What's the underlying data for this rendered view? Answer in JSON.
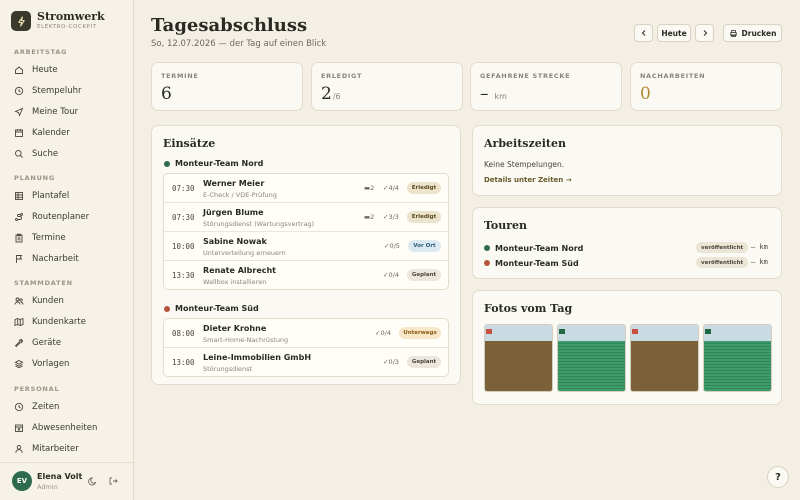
{
  "brand": {
    "name": "Stromwerk",
    "sub": "ELEKTRO-COCKPIT"
  },
  "sidebar": {
    "sections": [
      {
        "label": "ARBEITSTAG",
        "items": [
          {
            "label": "Heute",
            "icon": "home-icon"
          },
          {
            "label": "Stempeluhr",
            "icon": "clock-icon"
          },
          {
            "label": "Meine Tour",
            "icon": "send-icon"
          },
          {
            "label": "Kalender",
            "icon": "calendar-icon"
          },
          {
            "label": "Suche",
            "icon": "search-icon"
          }
        ]
      },
      {
        "label": "PLANUNG",
        "items": [
          {
            "label": "Plantafel",
            "icon": "grid-icon"
          },
          {
            "label": "Routenplaner",
            "icon": "route-icon"
          },
          {
            "label": "Termine",
            "icon": "clipboard-icon"
          },
          {
            "label": "Nacharbeit",
            "icon": "flag-icon"
          }
        ]
      },
      {
        "label": "STAMMDATEN",
        "items": [
          {
            "label": "Kunden",
            "icon": "users-icon"
          },
          {
            "label": "Kundenkarte",
            "icon": "map-icon"
          },
          {
            "label": "Geräte",
            "icon": "wrench-icon"
          },
          {
            "label": "Vorlagen",
            "icon": "layers-icon"
          }
        ]
      },
      {
        "label": "PERSONAL",
        "items": [
          {
            "label": "Zeiten",
            "icon": "clock-icon"
          },
          {
            "label": "Abwesenheiten",
            "icon": "calendar-x-icon"
          },
          {
            "label": "Mitarbeiter",
            "icon": "user-icon"
          }
        ]
      }
    ]
  },
  "user": {
    "initials": "EV",
    "name": "Elena Volt",
    "role": "Admin"
  },
  "header": {
    "title": "Tagesabschluss",
    "subtitle": "So, 12.07.2026 — der Tag auf einen Blick",
    "today_label": "Heute",
    "print_label": "Drucken"
  },
  "stats": [
    {
      "label": "TERMINE",
      "value": "6",
      "unit": ""
    },
    {
      "label": "ERLEDIGT",
      "value": "2",
      "unit": "/6"
    },
    {
      "label": "GEFAHRENE STRECKE",
      "value": "–",
      "unit": "km"
    },
    {
      "label": "NACHARBEITEN",
      "value": "0",
      "unit": ""
    }
  ],
  "einsaetze": {
    "title": "Einsätze",
    "teams": [
      {
        "name": "Monteur-Team Nord",
        "color": "#2e6b4e",
        "rows": [
          {
            "time": "07:30",
            "name": "Werner Meier",
            "desc": "E-Check / VDE-Prüfung",
            "extra": "▬2",
            "check": "✓4/4",
            "status": "Erledigt",
            "status_kind": "done"
          },
          {
            "time": "07:30",
            "name": "Jürgen Blume",
            "desc": "Störungsdienst (Wartungsvertrag)",
            "extra": "▬2",
            "check": "✓3/3",
            "status": "Erledigt",
            "status_kind": "done"
          },
          {
            "time": "10:00",
            "name": "Sabine Nowak",
            "desc": "Unterverteilung erneuern",
            "extra": "",
            "check": "✓0/5",
            "status": "Vor Ort",
            "status_kind": "onsite"
          },
          {
            "time": "13:30",
            "name": "Renate Albrecht",
            "desc": "Wallbox installieren",
            "extra": "",
            "check": "✓0/4",
            "status": "Geplant",
            "status_kind": "planned"
          }
        ]
      },
      {
        "name": "Monteur-Team Süd",
        "color": "#b5553a",
        "rows": [
          {
            "time": "08:00",
            "name": "Dieter Krohne",
            "desc": "Smart-Home-Nachrüstung",
            "extra": "",
            "check": "✓0/4",
            "status": "Unterwegs",
            "status_kind": "enroute"
          },
          {
            "time": "13:00",
            "name": "Leine-Immobilien GmbH",
            "desc": "Störungsdienst",
            "extra": "",
            "check": "✓0/3",
            "status": "Geplant",
            "status_kind": "planned"
          }
        ]
      }
    ]
  },
  "arbeitszeiten": {
    "title": "Arbeitszeiten",
    "empty": "Keine Stempelungen.",
    "link": "Details unter Zeiten →"
  },
  "touren": {
    "title": "Touren",
    "rows": [
      {
        "name": "Monteur-Team Nord",
        "color": "#2e6b4e",
        "badge": "veröffentlicht",
        "km": "– km"
      },
      {
        "name": "Monteur-Team Süd",
        "color": "#b5553a",
        "badge": "veröffentlicht",
        "km": "– km"
      }
    ]
  },
  "fotos": {
    "title": "Fotos vom Tag",
    "photos": [
      {
        "kind": "brown"
      },
      {
        "kind": "green"
      },
      {
        "kind": "brown"
      },
      {
        "kind": "green"
      }
    ]
  },
  "help_label": "?",
  "colors": {
    "accent": "#2e6b4e",
    "accent_south": "#b5553a",
    "gold": "#b08a2e"
  }
}
